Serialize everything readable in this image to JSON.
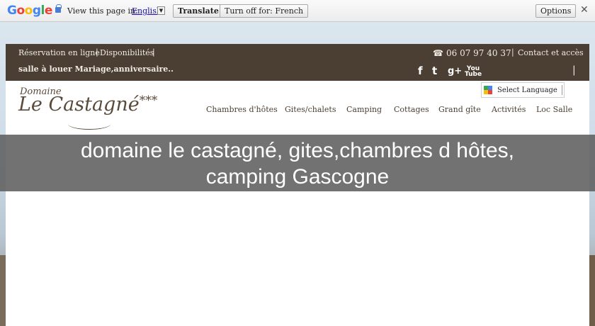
{
  "translate_bar": {
    "logo": {
      "G": "G",
      "o1": "o",
      "o2": "o",
      "g": "g",
      "l": "l",
      "e": "e"
    },
    "view_text": "View this page in:",
    "language": "English",
    "dropdown_glyph": "▼",
    "translate_button": "Translate",
    "turn_off_button": "Turn off for: French",
    "options_button": "Options",
    "close_glyph": "✕"
  },
  "topbar": {
    "reservation": "Réservation en ligne",
    "sep": "|",
    "disponibilites": "Disponibilités",
    "salle": "salle à louer Mariage,anniversaire..",
    "phone_icon": "☎",
    "phone": "06 07 97 40 37",
    "contact": "Contact et accès",
    "social": {
      "facebook": "f",
      "twitter": "t",
      "googleplus": "g+",
      "youtube_top": "You",
      "youtube_bottom": "Tube"
    }
  },
  "logo": {
    "small": "Domaine",
    "big": "Le Castagné",
    "stars": "***"
  },
  "google_translate": {
    "label": "Select Language"
  },
  "nav": {
    "items": [
      "Chambres d'hôtes",
      "Gites/chalets",
      "Camping",
      "Cottages",
      "Grand gîte",
      "Activités",
      "Loc Salle"
    ]
  },
  "caption": {
    "line1": "domaine le castagné, gites,chambres d hôtes,",
    "line2": "camping Gascogne"
  },
  "colors": {
    "topbar_bg": "#4b3f33",
    "caption_bg": "#5f5f5f",
    "nav_text": "#4b3f33"
  }
}
